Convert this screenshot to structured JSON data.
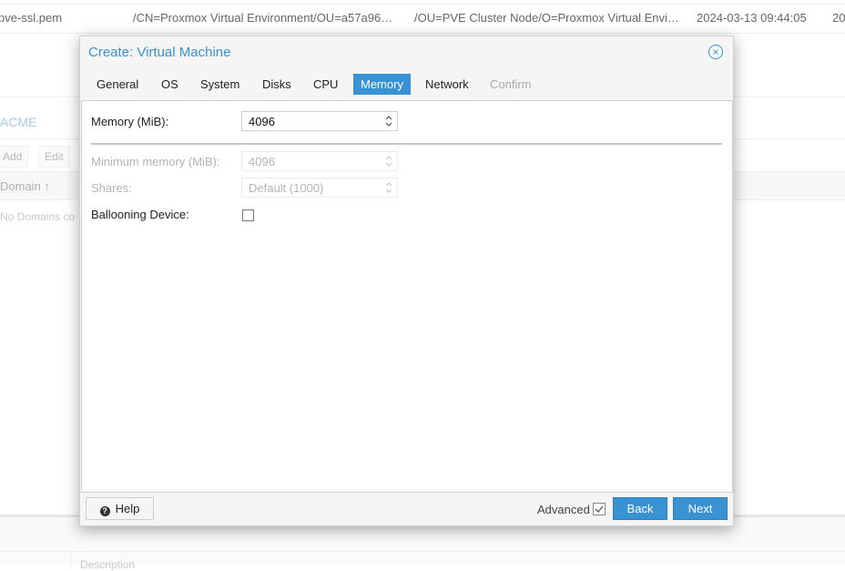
{
  "background": {
    "row": {
      "name": "pve-ssl.pem",
      "subject": "/CN=Proxmox Virtual Environment/OU=a57a96…",
      "issuer": "/OU=PVE Cluster Node/O=Proxmox Virtual Envi…",
      "date": "2024-03-13 09:44:05",
      "date2": "20"
    },
    "acme_title": "ACME",
    "buttons": {
      "add": "Add",
      "edit": "Edit"
    },
    "column_header": "Domain ↑",
    "empty_text": "No Domains co",
    "description_label": "Description"
  },
  "dialog": {
    "title": "Create: Virtual Machine",
    "tabs": [
      {
        "label": "General",
        "state": "normal"
      },
      {
        "label": "OS",
        "state": "normal"
      },
      {
        "label": "System",
        "state": "normal"
      },
      {
        "label": "Disks",
        "state": "normal"
      },
      {
        "label": "CPU",
        "state": "normal"
      },
      {
        "label": "Memory",
        "state": "active"
      },
      {
        "label": "Network",
        "state": "normal"
      },
      {
        "label": "Confirm",
        "state": "disabled"
      }
    ],
    "fields": {
      "memory": {
        "label": "Memory (MiB):",
        "value": "4096"
      },
      "min_memory": {
        "label": "Minimum memory (MiB):",
        "value": "4096"
      },
      "shares": {
        "label": "Shares:",
        "value": "Default (1000)"
      },
      "ballooning": {
        "label": "Ballooning Device:",
        "checked": false
      }
    },
    "footer": {
      "help_label": "Help",
      "advanced_label": "Advanced",
      "advanced_checked": true,
      "back_label": "Back",
      "next_label": "Next"
    }
  },
  "colors": {
    "accent": "#3892d4",
    "disabled_text": "#b4b4b4"
  }
}
